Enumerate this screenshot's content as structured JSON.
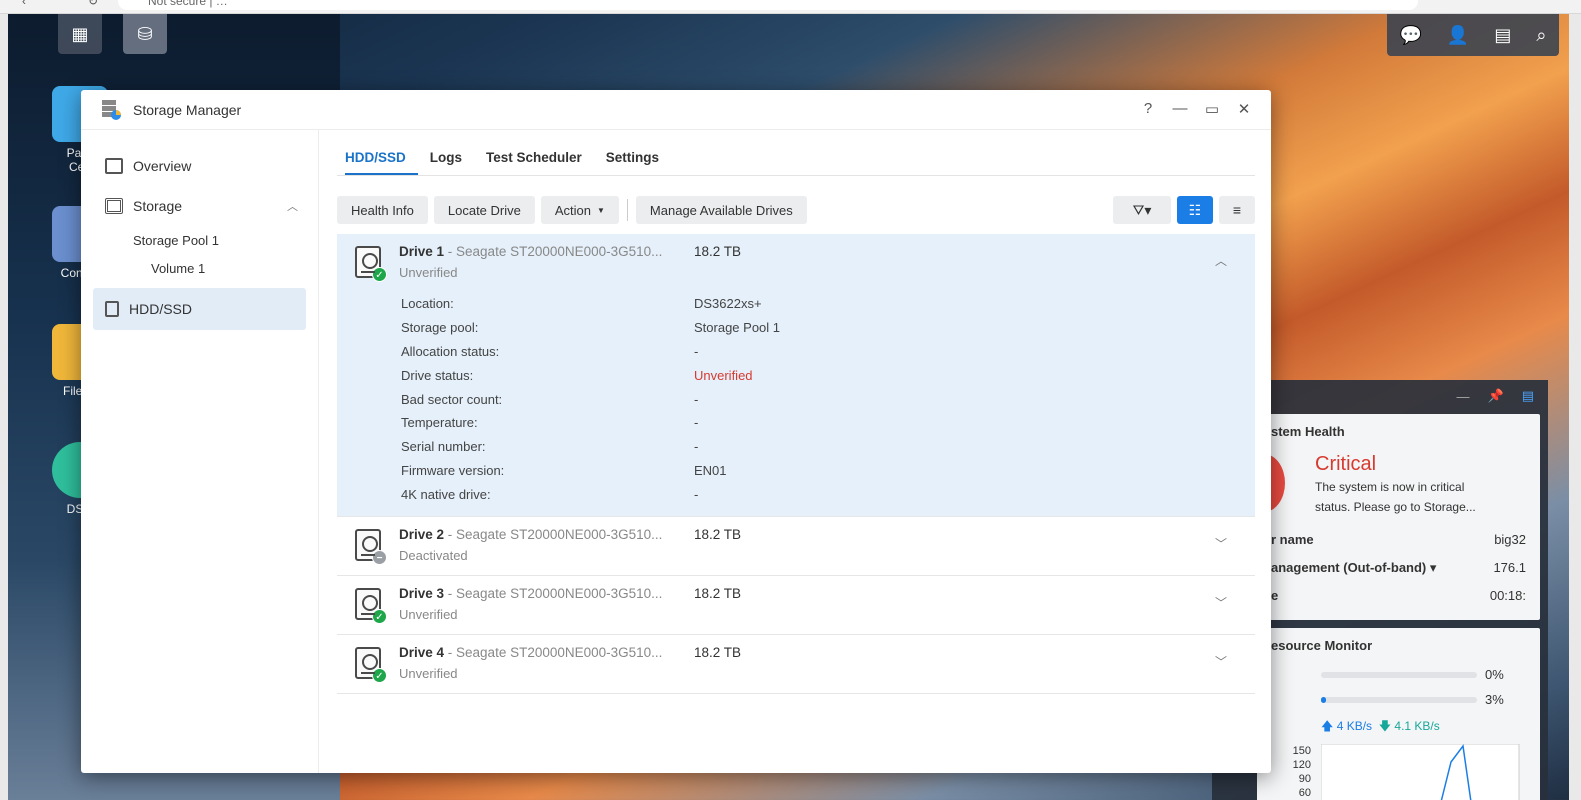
{
  "browser": {
    "address": "Not secure  |  …"
  },
  "taskbar": {
    "main_menu_icon": "grid-icon",
    "storage_icon": "storage-manager-icon"
  },
  "tray": {
    "icons": [
      "chat-icon",
      "user-icon",
      "widgets-icon",
      "search-icon"
    ]
  },
  "desktop_icons": [
    {
      "label": "Pack\nCen",
      "color": "#3fa9e8"
    },
    {
      "label": "Control",
      "color": "#6b8fcf"
    },
    {
      "label": "File St",
      "color": "#f0b73a"
    },
    {
      "label": "DSM",
      "color": "#2fbf9c"
    }
  ],
  "window": {
    "title": "Storage Manager",
    "controls": {
      "help": "?",
      "minimize": "—",
      "maximize": "▭",
      "close": "✕"
    }
  },
  "sidebar": {
    "overview": "Overview",
    "storage": "Storage",
    "storage_pool": "Storage Pool 1",
    "volume": "Volume 1",
    "hdd_ssd": "HDD/SSD"
  },
  "tabs": [
    "HDD/SSD",
    "Logs",
    "Test Scheduler",
    "Settings"
  ],
  "toolbar": {
    "health_info": "Health Info",
    "locate_drive": "Locate Drive",
    "action": "Action",
    "manage": "Manage Available Drives"
  },
  "drives": [
    {
      "name": "Drive 1",
      "model": " - Seagate ST20000NE000-3G510...",
      "size": "18.2 TB",
      "status": "Unverified",
      "badge": "ok",
      "expanded": true,
      "details": [
        {
          "k": "Location:",
          "v": "DS3622xs+"
        },
        {
          "k": "Storage pool:",
          "v": "Storage Pool 1"
        },
        {
          "k": "Allocation status:",
          "v": "-"
        },
        {
          "k": "Drive status:",
          "v": "Unverified",
          "alert": true
        },
        {
          "k": "Bad sector count:",
          "v": "-"
        },
        {
          "k": "Temperature:",
          "v": "-"
        },
        {
          "k": "Serial number:",
          "v": "-"
        },
        {
          "k": "Firmware version:",
          "v": "EN01"
        },
        {
          "k": "4K native drive:",
          "v": "-"
        }
      ]
    },
    {
      "name": "Drive 2",
      "model": " - Seagate ST20000NE000-3G510...",
      "size": "18.2 TB",
      "status": "Deactivated",
      "badge": "off",
      "expanded": false
    },
    {
      "name": "Drive 3",
      "model": " - Seagate ST20000NE000-3G510...",
      "size": "18.2 TB",
      "status": "Unverified",
      "badge": "ok",
      "expanded": false
    },
    {
      "name": "Drive 4",
      "model": " - Seagate ST20000NE000-3G510...",
      "size": "18.2 TB",
      "status": "Unverified",
      "badge": "ok",
      "expanded": false
    }
  ],
  "widgets": {
    "health": {
      "title": "stem Health",
      "state": "Critical",
      "message_1": "The system is now in critical",
      "message_2": "status. Please go to Storage...",
      "rows": [
        {
          "k": "r name",
          "v": "big32"
        },
        {
          "k": "anagement (Out-of-band) ▾",
          "v": "176.1"
        },
        {
          "k": "e",
          "v": "00:18:"
        }
      ]
    },
    "resource": {
      "title": "esource Monitor",
      "cpu_pct": "0%",
      "cpu_fill": 0.0,
      "ram_pct": "3%",
      "ram_fill": 0.03,
      "upload": "4 KB/s",
      "download": "4.1 KB/s",
      "y_ticks": [
        "150",
        "120",
        "90",
        "60"
      ]
    }
  }
}
